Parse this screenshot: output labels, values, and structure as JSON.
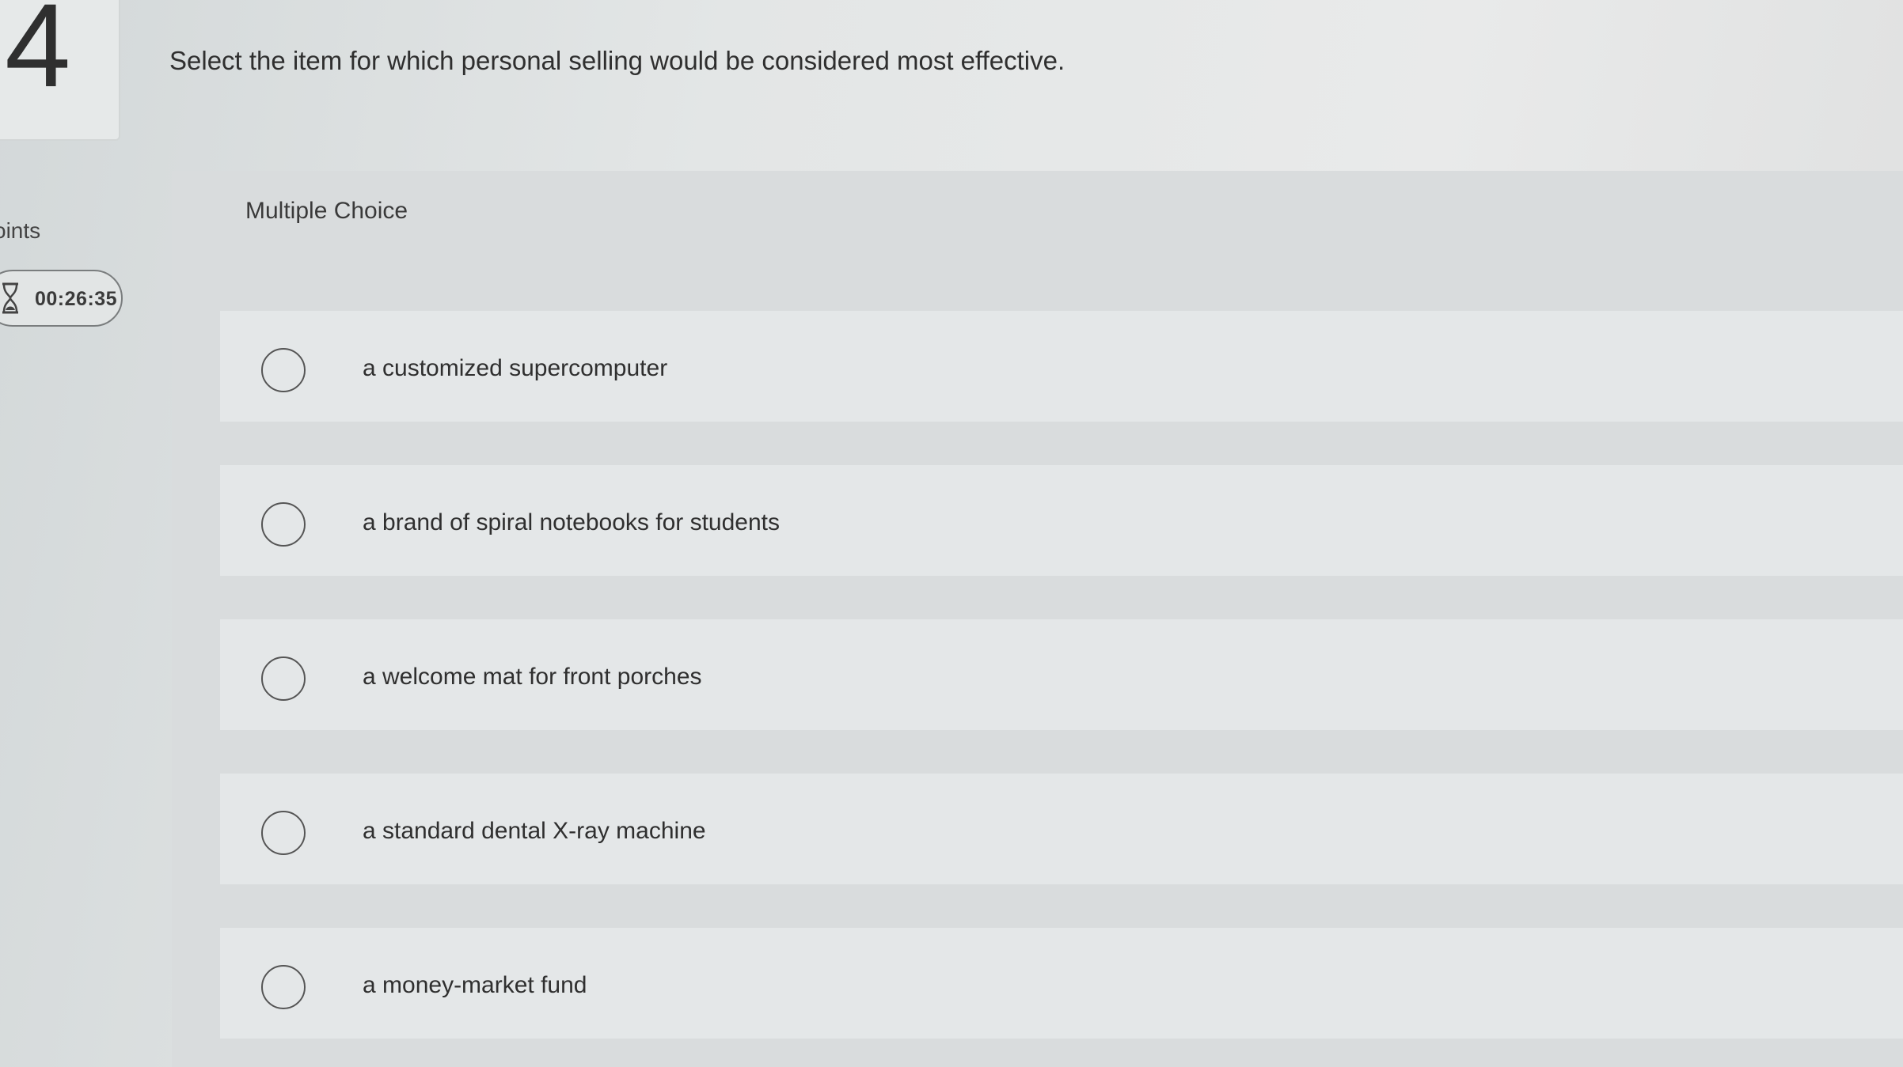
{
  "question_number": "4",
  "points_label": "oints",
  "timer": {
    "icon": "hourglass-icon",
    "time": "00:26:35"
  },
  "question_text": "Select the item for which personal selling would be considered most effective.",
  "question_type": "Multiple Choice",
  "options": [
    {
      "label": "a customized supercomputer"
    },
    {
      "label": "a brand of spiral notebooks for students"
    },
    {
      "label": "a welcome mat for front porches"
    },
    {
      "label": "a standard dental X-ray machine"
    },
    {
      "label": "a money-market fund"
    }
  ]
}
